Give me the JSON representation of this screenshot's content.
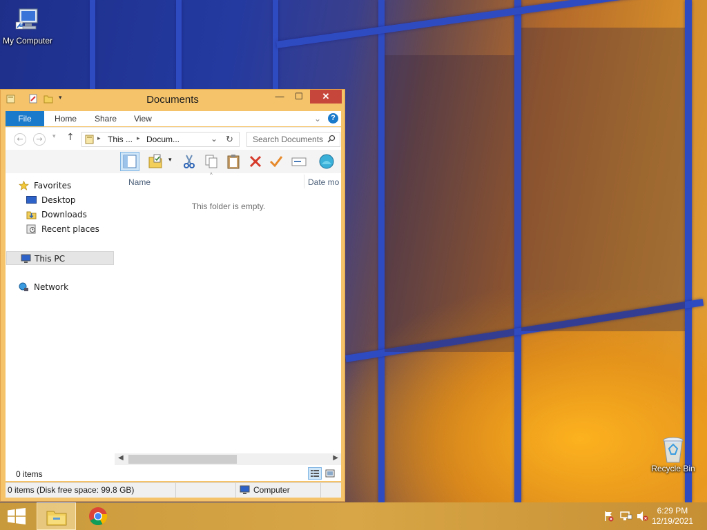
{
  "desktop": {
    "icons": {
      "my_computer": "My Computer",
      "recycle_bin": "Recycle Bin"
    }
  },
  "window": {
    "title": "Documents",
    "tabs": {
      "file": "File",
      "home": "Home",
      "share": "Share",
      "view": "View"
    },
    "address": {
      "crumb1": "This ...",
      "crumb2": "Docum..."
    },
    "search": {
      "placeholder": "Search Documents"
    },
    "columns": {
      "name": "Name",
      "date": "Date mo"
    },
    "empty_message": "This folder is empty.",
    "nav": {
      "favorites": "Favorites",
      "desktop": "Desktop",
      "downloads": "Downloads",
      "recent": "Recent places",
      "this_pc": "This PC",
      "network": "Network"
    },
    "status": {
      "items": "0 items"
    },
    "details": {
      "free_space": "0 items (Disk free space: 99.8 GB)",
      "location": "Computer"
    }
  },
  "taskbar": {
    "time": "6:29 PM",
    "date": "12/19/2021"
  },
  "colors": {
    "window_frame": "#f5c36a",
    "file_tab": "#1979ca",
    "close_button": "#c7463c",
    "taskbar": "#d8a646"
  }
}
